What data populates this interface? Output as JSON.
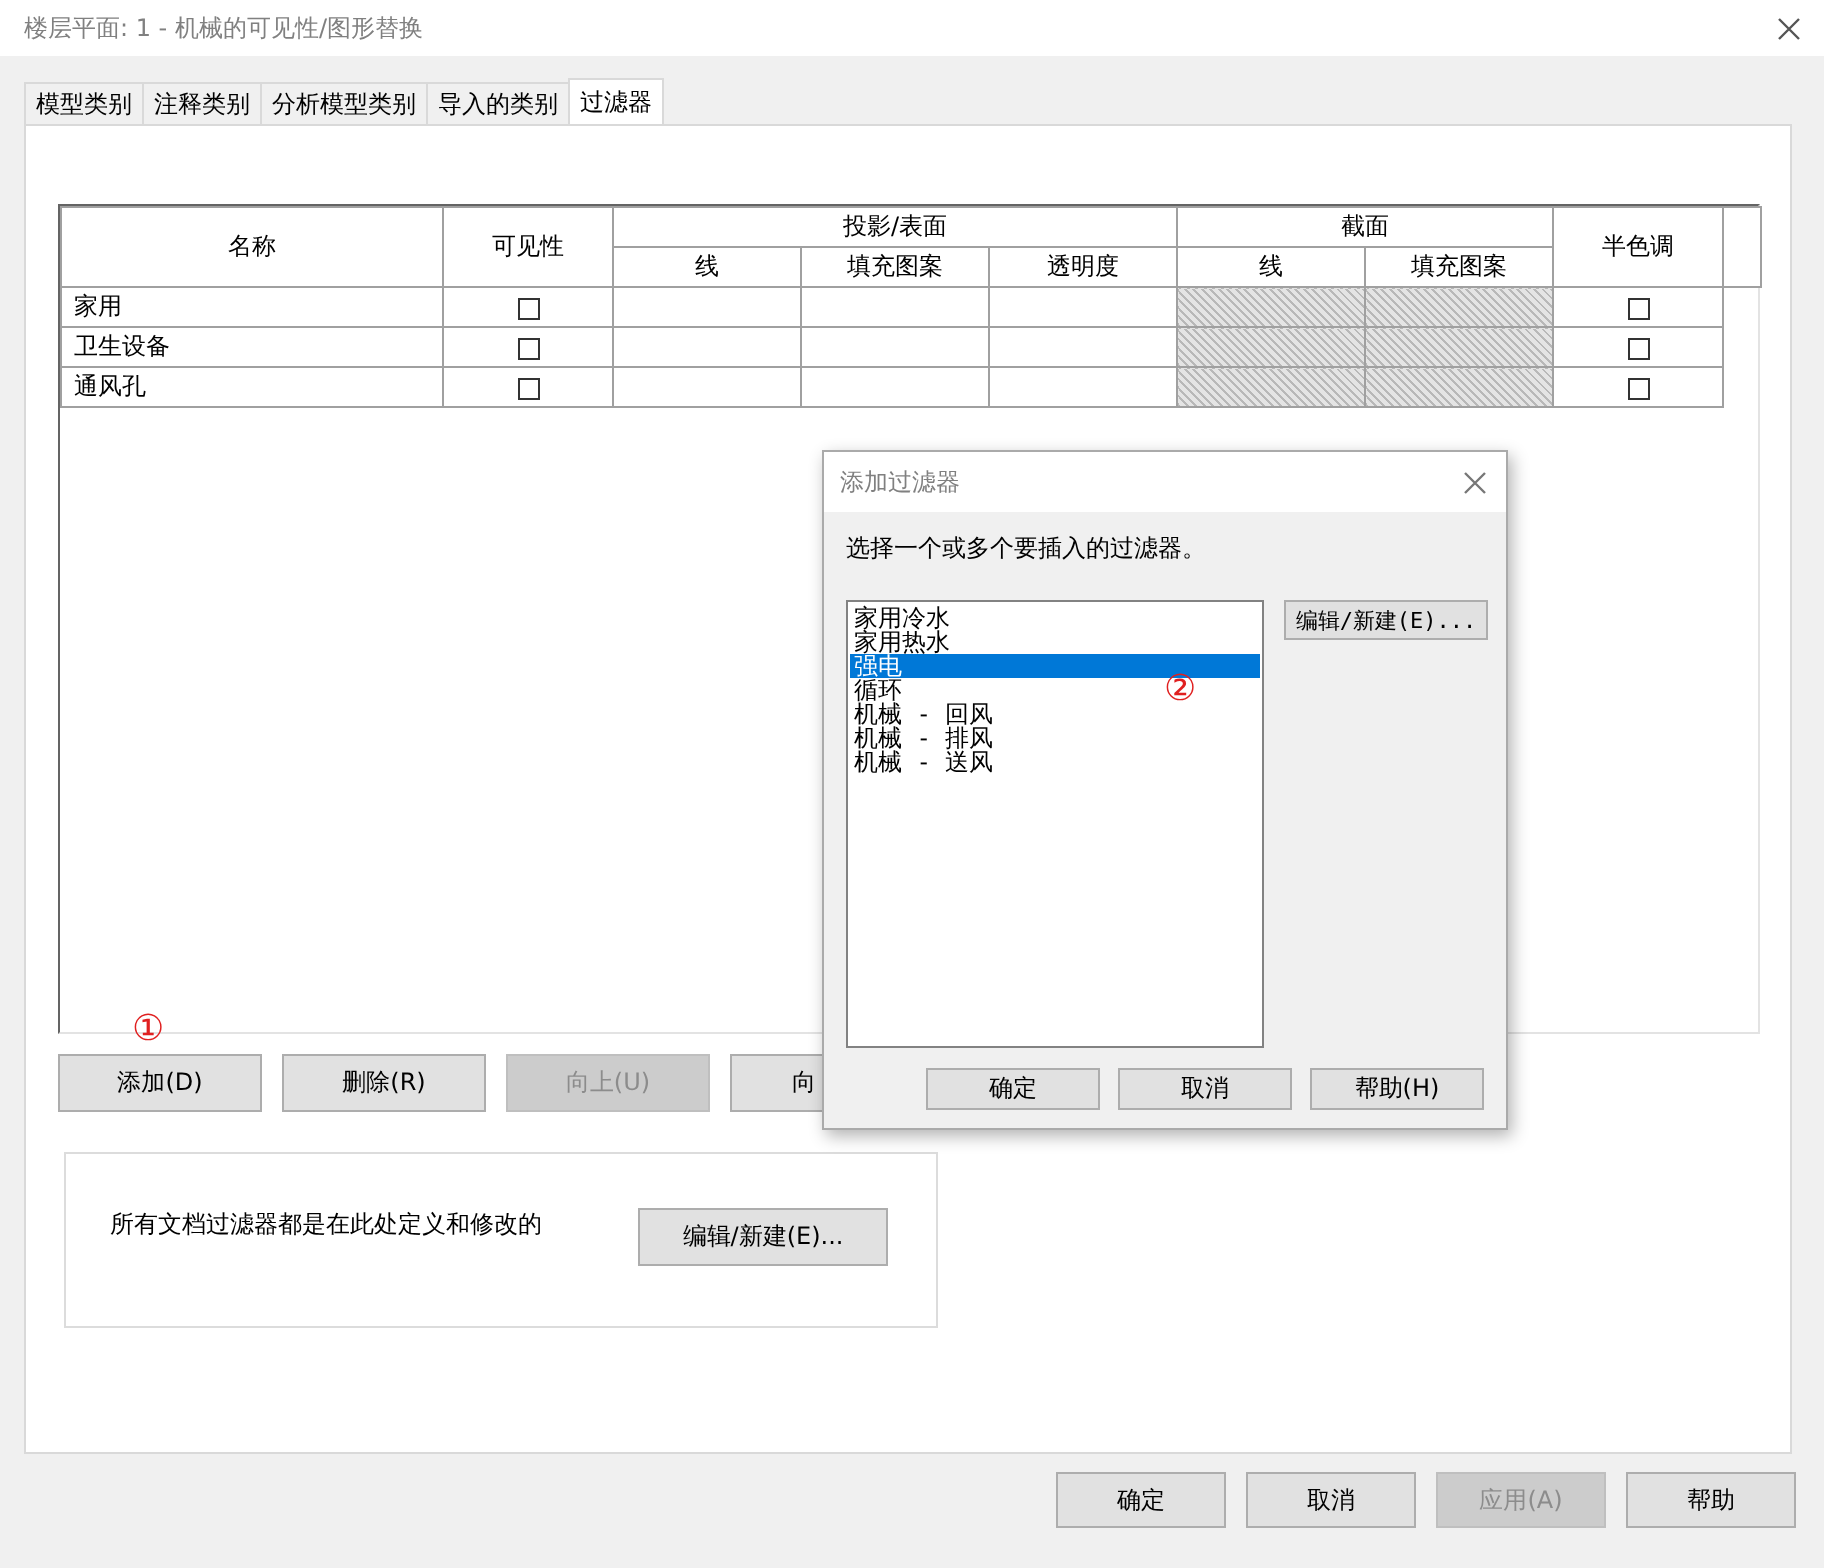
{
  "window": {
    "title": "楼层平面: 1 - 机械的可见性/图形替换"
  },
  "tabs": [
    {
      "label": "模型类别",
      "selected": false
    },
    {
      "label": "注释类别",
      "selected": false
    },
    {
      "label": "分析模型类别",
      "selected": false
    },
    {
      "label": "导入的类别",
      "selected": false
    },
    {
      "label": "过滤器",
      "selected": true
    }
  ],
  "table": {
    "columns": {
      "name": "名称",
      "visibility": "可见性",
      "projection": {
        "label": "投影/表面",
        "sub": [
          "线",
          "填充图案",
          "透明度"
        ]
      },
      "cut": {
        "label": "截面",
        "sub": [
          "线",
          "填充图案"
        ]
      },
      "halftone": "半色调"
    },
    "rows": [
      {
        "name": "家用",
        "visible": false,
        "halftone": false
      },
      {
        "name": "卫生设备",
        "visible": false,
        "halftone": false
      },
      {
        "name": "通风孔",
        "visible": false,
        "halftone": false
      }
    ]
  },
  "table_buttons": [
    {
      "label": "添加(D)",
      "disabled": false
    },
    {
      "label": "删除(R)",
      "disabled": false
    },
    {
      "label": "向上(U)",
      "disabled": true
    },
    {
      "label": "向",
      "disabled": false
    }
  ],
  "filters_group": {
    "text": "所有文档过滤器都是在此处定义和修改的",
    "button": "编辑/新建(E)..."
  },
  "footer_buttons": [
    {
      "label": "确定",
      "disabled": false
    },
    {
      "label": "取消",
      "disabled": false
    },
    {
      "label": "应用(A)",
      "disabled": true
    },
    {
      "label": "帮助",
      "disabled": false
    }
  ],
  "dialog": {
    "title": "添加过滤器",
    "prompt": "选择一个或多个要插入的过滤器。",
    "filters": [
      {
        "label": "家用冷水",
        "selected": false
      },
      {
        "label": "家用热水",
        "selected": false
      },
      {
        "label": "强电",
        "selected": true
      },
      {
        "label": "循环",
        "selected": false
      },
      {
        "label": "机械 - 回风",
        "selected": false
      },
      {
        "label": "机械 - 排风",
        "selected": false
      },
      {
        "label": "机械 - 送风",
        "selected": false
      }
    ],
    "edit_button": "编辑/新建(E)...",
    "buttons": [
      "确定",
      "取消",
      "帮助(H)"
    ]
  },
  "annotations": [
    {
      "text": "①"
    },
    {
      "text": "②"
    }
  ]
}
